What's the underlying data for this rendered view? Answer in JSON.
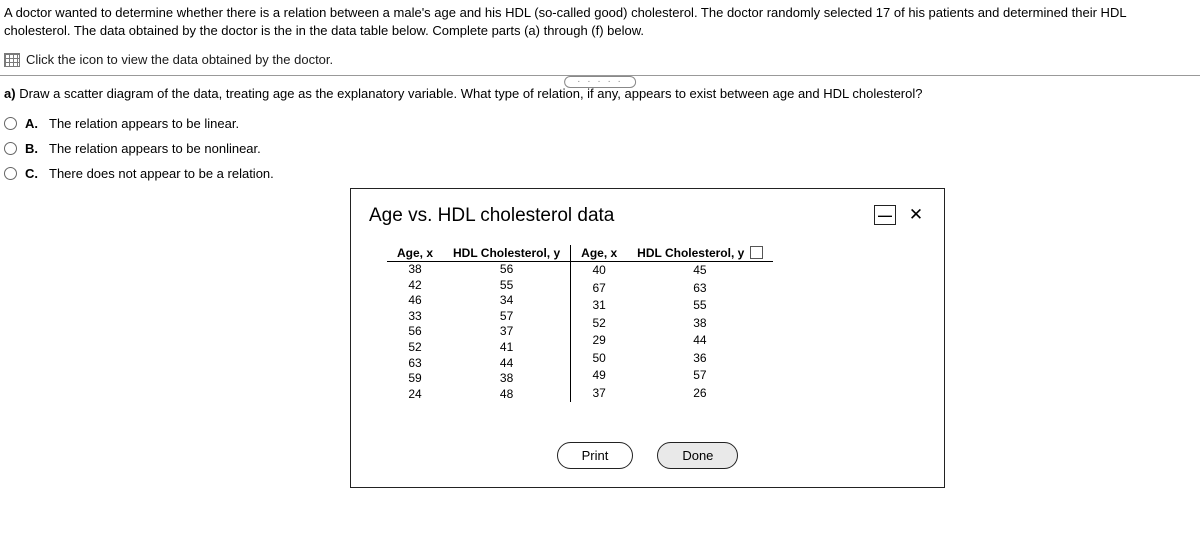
{
  "intro": "A doctor wanted to determine whether there is a relation between a male's age and his HDL (so-called good) cholesterol. The doctor randomly selected 17 of his patients and determined their HDL cholesterol. The data obtained by the doctor is the in the data table below. Complete parts (a) through (f) below.",
  "data_link": "Click the icon to view the data obtained by the doctor.",
  "part_a": {
    "label": "a)",
    "text": "Draw a scatter diagram of the data, treating age as the explanatory variable. What type of relation, if any, appears to exist between age and HDL cholesterol?"
  },
  "options": [
    {
      "letter": "A.",
      "text": "The relation appears to be linear."
    },
    {
      "letter": "B.",
      "text": "The relation appears to be nonlinear."
    },
    {
      "letter": "C.",
      "text": "There does not appear to be a relation."
    }
  ],
  "modal": {
    "title": "Age vs. HDL cholesterol data",
    "headers": {
      "age": "Age, x",
      "hdl": "HDL Cholesterol, y"
    },
    "left_rows": [
      {
        "age": "38",
        "hdl": "56"
      },
      {
        "age": "42",
        "hdl": "55"
      },
      {
        "age": "46",
        "hdl": "34"
      },
      {
        "age": "33",
        "hdl": "57"
      },
      {
        "age": "56",
        "hdl": "37"
      },
      {
        "age": "52",
        "hdl": "41"
      },
      {
        "age": "63",
        "hdl": "44"
      },
      {
        "age": "59",
        "hdl": "38"
      },
      {
        "age": "24",
        "hdl": "48"
      }
    ],
    "right_rows": [
      {
        "age": "40",
        "hdl": "45"
      },
      {
        "age": "67",
        "hdl": "63"
      },
      {
        "age": "31",
        "hdl": "55"
      },
      {
        "age": "52",
        "hdl": "38"
      },
      {
        "age": "29",
        "hdl": "44"
      },
      {
        "age": "50",
        "hdl": "36"
      },
      {
        "age": "49",
        "hdl": "57"
      },
      {
        "age": "37",
        "hdl": "26"
      }
    ],
    "print": "Print",
    "done": "Done"
  },
  "dots": "· · · · ·"
}
